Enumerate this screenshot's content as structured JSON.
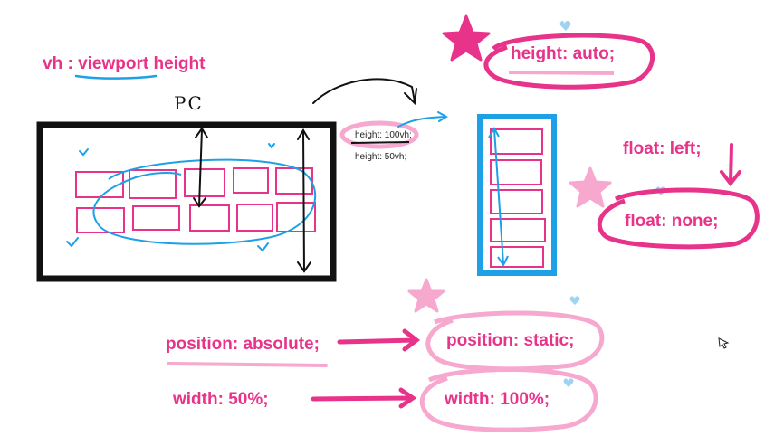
{
  "notes": {
    "vh_prefix": "vh : ",
    "vh_word": "viewport",
    "vh_suffix": " height",
    "pc": "PC",
    "height_100vh": "height: 100vh;",
    "height_50vh": "height: 50vh;",
    "height_auto": "height: auto;",
    "float_left": "float: left;",
    "float_none": "float: none;",
    "position_absolute": "position: absolute;",
    "position_static": "position: static;",
    "width_50": "width: 50%;",
    "width_100": "width: 100%;"
  },
  "colors": {
    "pink": "#e8338a",
    "light_pink": "#f7a8cf",
    "blue": "#1ea0e6",
    "black": "#111111"
  },
  "icons": [
    "star-icon",
    "heart-icon",
    "mouse-cursor-icon"
  ]
}
